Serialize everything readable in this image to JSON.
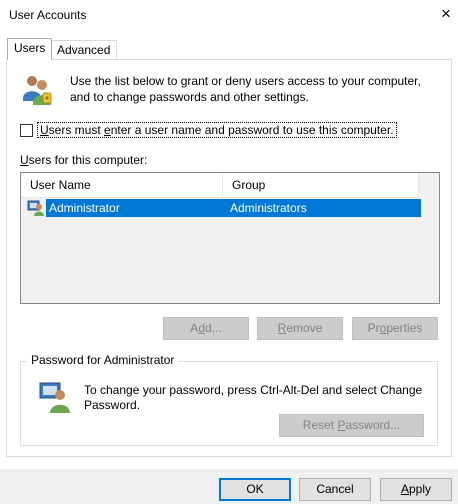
{
  "window": {
    "title": "User Accounts",
    "close_glyph": "×"
  },
  "tabs": [
    {
      "label": "Users",
      "active": true
    },
    {
      "label": "Advanced",
      "active": false
    }
  ],
  "intro": {
    "icon": "users-icon",
    "line1": "Use the list below to grant or deny users access to your computer,",
    "line2": "and to change passwords and other settings."
  },
  "checkbox": {
    "checked": false,
    "label_first": "U",
    "label_mid1": "sers must ",
    "label_accel": "e",
    "label_rest": "nter a user name and password to use this computer."
  },
  "users_list": {
    "label_accel": "U",
    "label_rest": "sers for this computer:",
    "columns": [
      "User Name",
      "Group"
    ],
    "rows": [
      {
        "icon": "user-icon",
        "user_name": "Administrator",
        "group": "Administrators",
        "selected": true
      }
    ]
  },
  "list_buttons": {
    "add": {
      "pre": "A",
      "accel": "d",
      "post": "d...",
      "enabled": false
    },
    "remove": {
      "pre": "",
      "accel": "R",
      "post": "emove",
      "enabled": true
    },
    "properties": {
      "pre": "Pr",
      "accel": "o",
      "post": "perties",
      "enabled": true
    }
  },
  "password_group": {
    "legend": "Password for Administrator",
    "icon": "user-password-icon",
    "line1": "To change your password, press Ctrl-Alt-Del and select Change",
    "line2": "Password.",
    "reset_button": {
      "pre": "Reset ",
      "accel": "P",
      "post": "assword...",
      "enabled": false
    }
  },
  "dialog_buttons": {
    "ok": "OK",
    "cancel": "Cancel",
    "apply": {
      "accel": "A",
      "post": "pply"
    }
  },
  "colors": {
    "selection": "#0078d7",
    "accent_border": "#0078d7",
    "footer_bg": "#f0f0f0"
  }
}
